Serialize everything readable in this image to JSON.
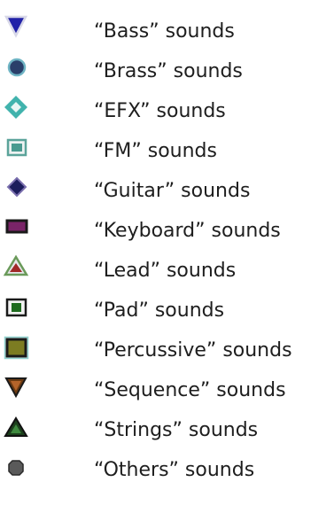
{
  "legend": {
    "items": [
      {
        "label": "“Bass” sounds",
        "icon": "blue-down-triangle-icon",
        "color": "#2222a8"
      },
      {
        "label": "“Brass” sounds",
        "icon": "blue-circle-icon",
        "color": "#2a3f6a"
      },
      {
        "label": "“EFX” sounds",
        "icon": "teal-diamond-icon",
        "color": "#41b3ad"
      },
      {
        "label": "“FM” sounds",
        "icon": "teal-square-icon",
        "color": "#5ba39a"
      },
      {
        "label": "“Guitar” sounds",
        "icon": "navy-diamond-icon",
        "color": "#1c1d5c"
      },
      {
        "label": "“Keyboard” sounds",
        "icon": "purple-rectangle-icon",
        "color": "#7a2468"
      },
      {
        "label": "“Lead” sounds",
        "icon": "red-up-triangle-icon",
        "color": "#a02828"
      },
      {
        "label": "“Pad” sounds",
        "icon": "green-square-icon",
        "color": "#1f6b1f"
      },
      {
        "label": "“Percussive” sounds",
        "icon": "olive-square-icon",
        "color": "#7c7c22"
      },
      {
        "label": "“Sequence” sounds",
        "icon": "brown-down-triangle-icon",
        "color": "#6b3a12"
      },
      {
        "label": "“Strings” sounds",
        "icon": "darkgreen-up-triangle-icon",
        "color": "#1c3f1c"
      },
      {
        "label": "“Others” sounds",
        "icon": "gray-octagon-icon",
        "color": "#5a5a5a"
      }
    ]
  }
}
